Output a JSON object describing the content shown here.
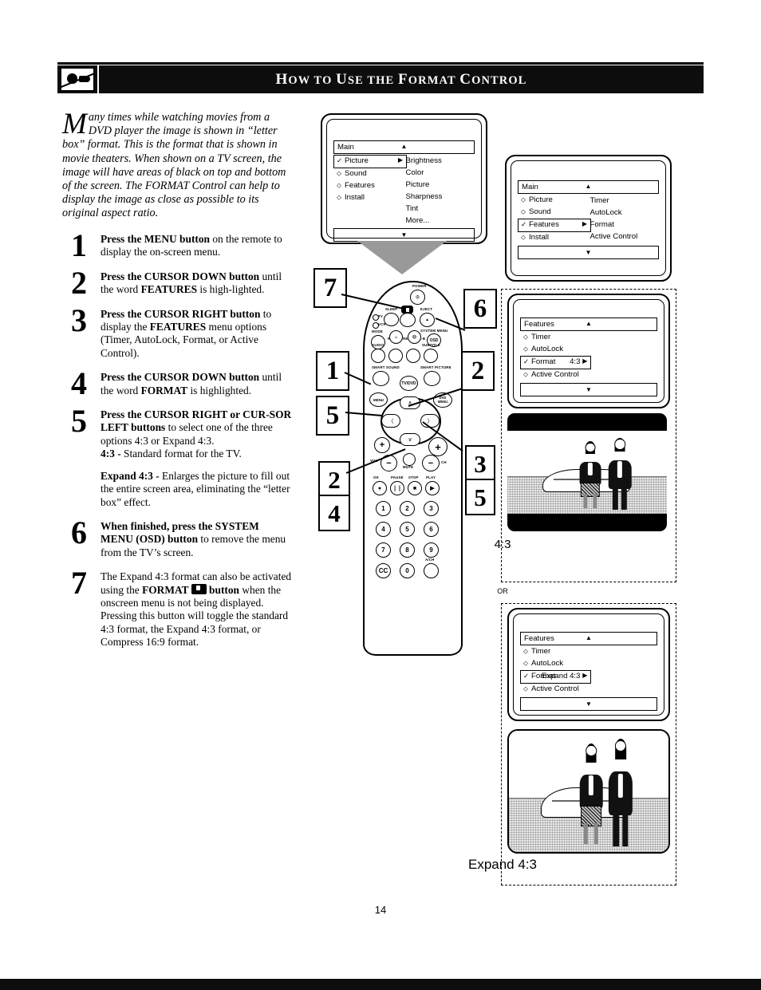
{
  "header": {
    "title_parts": [
      {
        "text": "H",
        "small": false
      },
      {
        "text": "OW TO ",
        "small": true
      },
      {
        "text": "U",
        "small": false
      },
      {
        "text": "SE THE ",
        "small": true
      },
      {
        "text": "F",
        "small": false
      },
      {
        "text": "ORMAT ",
        "small": true
      },
      {
        "text": "C",
        "small": false
      },
      {
        "text": "ONTROL",
        "small": true
      }
    ],
    "title": "HOW TO USE THE FORMAT CONTROL",
    "icon": "hand-pointing-at-screen-icon"
  },
  "intro": {
    "dropcap": "M",
    "text": "any times while watching movies from a DVD player the image is shown in “letter box” format. This is the format that is shown in movie theaters. When shown on a TV screen, the image will have areas of black on top and bottom of the screen. The FORMAT Control can help to display the image as close as possible to its original aspect ratio."
  },
  "steps": [
    {
      "number": "1",
      "html": "<b>Press the MENU button</b> on the remote to display the on-screen menu."
    },
    {
      "number": "2",
      "html": "<b>Press the CURSOR DOWN button</b> until the word <b>FEATURES</b> is high-lighted."
    },
    {
      "number": "3",
      "html": "<b>Press the CURSOR RIGHT button</b> to display the <b>FEATURES</b> menu options (Timer, AutoLock, Format, or Active Control)."
    },
    {
      "number": "4",
      "html": "<b>Press the CURSOR DOWN button</b> until the word <b>FORMAT</b> is highlighted."
    },
    {
      "number": "5",
      "html": "<b>Press the CURSOR RIGHT or CUR-SOR LEFT buttons</b> to select one of the three options 4:3 or Expand 4:3.<p><b>4:3 -</b> Standard format for the TV.</p><p><b>Expand 4:3 -</b> Enlarges the picture to fill out the entire screen area, eliminating the “letter box” effect.</p>"
    },
    {
      "number": "6",
      "html": "<b>When finished, press the SYSTEM MENU (OSD) button</b> to remove the menu from the TV’s screen."
    },
    {
      "number": "7",
      "html": "The Expand 4:3 format can also be activated using the <b>FORMAT <span class=\"fmt-glyph\"></span> button</b> when the onscreen menu is not being displayed. Pressing this button will toggle the standard 4:3 format, the Expand 4:3 format, or Compress 16:9 format."
    }
  ],
  "osd_menus": [
    {
      "id": "main-picture",
      "title": "Main",
      "up_arrow": "▲",
      "down_arrow": "▼",
      "rows": [
        {
          "bullet": "✓",
          "label": "Picture",
          "selected": true,
          "arrow": "▶"
        },
        {
          "bullet": "⬦",
          "label": "Sound",
          "selected": false
        },
        {
          "bullet": "⬦",
          "label": "Features",
          "selected": false
        },
        {
          "bullet": "⬦",
          "label": "Install",
          "selected": false
        }
      ],
      "submenu": [
        "Brightness",
        "Color",
        "Picture",
        "Sharpness",
        "Tint",
        "More..."
      ]
    },
    {
      "id": "main-features",
      "title": "Main",
      "up_arrow": "▲",
      "down_arrow": "▼",
      "rows": [
        {
          "bullet": "⬦",
          "label": "Picture",
          "selected": false
        },
        {
          "bullet": "⬦",
          "label": "Sound",
          "selected": false
        },
        {
          "bullet": "✓",
          "label": "Features",
          "selected": true,
          "arrow": "▶"
        },
        {
          "bullet": "⬦",
          "label": "Install",
          "selected": false
        }
      ],
      "submenu": [
        "Timer",
        "AutoLock",
        "Format",
        "Active Control"
      ]
    },
    {
      "id": "features-43",
      "title": "Features",
      "up_arrow": "▲",
      "down_arrow": "▼",
      "rows": [
        {
          "bullet": "⬦",
          "label": "Timer",
          "selected": false
        },
        {
          "bullet": "⬦",
          "label": "AutoLock",
          "selected": false
        },
        {
          "bullet": "✓",
          "label": "Format",
          "selected": true,
          "value": "4:3",
          "arrow": "▶"
        },
        {
          "bullet": "⬦",
          "label": "Active Control",
          "selected": false
        }
      ],
      "submenu": []
    },
    {
      "id": "features-expand43",
      "title": "Features",
      "up_arrow": "▲",
      "down_arrow": "▼",
      "rows": [
        {
          "bullet": "⬦",
          "label": "Timer",
          "selected": false
        },
        {
          "bullet": "⬦",
          "label": "AutoLock",
          "selected": false
        },
        {
          "bullet": "✓",
          "label": "Format",
          "selected": true,
          "value": "Expand 4:3",
          "arrow": "▶"
        },
        {
          "bullet": "⬦",
          "label": "Active Control",
          "selected": false
        }
      ],
      "submenu": []
    }
  ],
  "picture_panels": [
    {
      "id": "panel-43",
      "caption": "4:3",
      "letterbox": true
    },
    {
      "id": "panel-expand43",
      "caption": "Expand 4:3",
      "letterbox": false
    }
  ],
  "or_label": "OR",
  "callouts": [
    {
      "number": "7",
      "target": "format-button"
    },
    {
      "number": "6",
      "target": "osd-button"
    },
    {
      "number": "1",
      "target": "menu-button"
    },
    {
      "number": "2",
      "target": "cursor-down-button"
    },
    {
      "number": "5",
      "target": "cursor-left-button"
    },
    {
      "number": "2",
      "target": "cursor-down-button"
    },
    {
      "number": "4",
      "target": "cursor-down-button"
    },
    {
      "number": "3",
      "target": "cursor-right-button"
    },
    {
      "number": "5",
      "target": "cursor-right-button"
    }
  ],
  "remote": {
    "power_label": "POWER",
    "power_icon": "power-icon",
    "sleep_label": "SLEEP",
    "format_label": "",
    "eject_label": "EJECT",
    "eject_icon": "▲",
    "tv_indicator": "TV",
    "vcr_indicator": "VCR",
    "mode_label": "MODE",
    "system_menu_label": "SYSTEM MENU",
    "osd_label": "OSD",
    "audio_label": "AUDIO",
    "replay_label": "REPLAY",
    "replay_ab_label": "REPLAY A-B",
    "subtitle_label": "SUBTITLE",
    "smart_sound_label": "SMART SOUND",
    "tv_dvd_label": "TV/DVD",
    "smart_picture_label": "SMART PICTURE",
    "menu_label": "MENU",
    "dvd_menu_label": "DVD MENU",
    "cursor_up": "∧",
    "cursor_down": "∨",
    "cursor_left": "〈",
    "cursor_right": "〉",
    "vol_label": "VOL",
    "ch_label": "CH",
    "mute_label": "MUTE",
    "plus": "+",
    "minus": "−",
    "transport": [
      {
        "label": "OK",
        "glyph": "●"
      },
      {
        "label": "PAUSE",
        "glyph": "❘❘"
      },
      {
        "label": "STOP",
        "glyph": "■"
      },
      {
        "label": "PLAY",
        "glyph": "▶"
      }
    ],
    "keypad": [
      "1",
      "2",
      "3",
      "4",
      "5",
      "6",
      "7",
      "8",
      "9",
      "CC",
      "0",
      ""
    ],
    "ach_label": "A/CH"
  },
  "page_number": "14"
}
